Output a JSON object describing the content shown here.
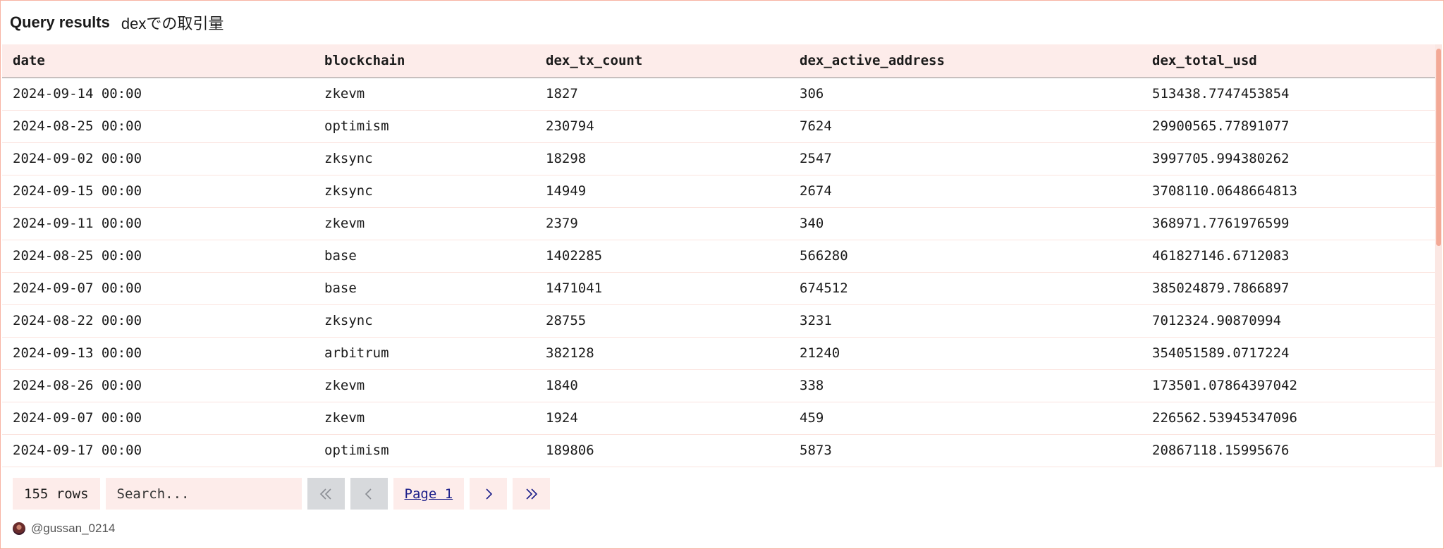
{
  "header": {
    "title": "Query results",
    "subtitle": "dexでの取引量"
  },
  "table": {
    "columns": [
      "date",
      "blockchain",
      "dex_tx_count",
      "dex_active_address",
      "dex_total_usd"
    ],
    "rows": [
      [
        "2024-09-14 00:00",
        "zkevm",
        "1827",
        "306",
        "513438.7747453854"
      ],
      [
        "2024-08-25 00:00",
        "optimism",
        "230794",
        "7624",
        "29900565.77891077"
      ],
      [
        "2024-09-02 00:00",
        "zksync",
        "18298",
        "2547",
        "3997705.994380262"
      ],
      [
        "2024-09-15 00:00",
        "zksync",
        "14949",
        "2674",
        "3708110.0648664813"
      ],
      [
        "2024-09-11 00:00",
        "zkevm",
        "2379",
        "340",
        "368971.7761976599"
      ],
      [
        "2024-08-25 00:00",
        "base",
        "1402285",
        "566280",
        "461827146.6712083"
      ],
      [
        "2024-09-07 00:00",
        "base",
        "1471041",
        "674512",
        "385024879.7866897"
      ],
      [
        "2024-08-22 00:00",
        "zksync",
        "28755",
        "3231",
        "7012324.90870994"
      ],
      [
        "2024-09-13 00:00",
        "arbitrum",
        "382128",
        "21240",
        "354051589.0717224"
      ],
      [
        "2024-08-26 00:00",
        "zkevm",
        "1840",
        "338",
        "173501.07864397042"
      ],
      [
        "2024-09-07 00:00",
        "zkevm",
        "1924",
        "459",
        "226562.53945347096"
      ],
      [
        "2024-09-17 00:00",
        "optimism",
        "189806",
        "5873",
        "20867118.15995676"
      ]
    ]
  },
  "footer": {
    "rows_label": "155 rows",
    "search_placeholder": "Search...",
    "page_label": "Page 1",
    "icons": [
      "double-chevron-left-icon",
      "chevron-left-icon",
      "chevron-right-icon",
      "double-chevron-right-icon"
    ]
  },
  "author": {
    "handle": "@gussan_0214"
  },
  "colors": {
    "accent_bg": "#fdecea",
    "border": "#f7b3a3",
    "link": "#1c1f8a",
    "disabled": "#d7d9dc"
  }
}
